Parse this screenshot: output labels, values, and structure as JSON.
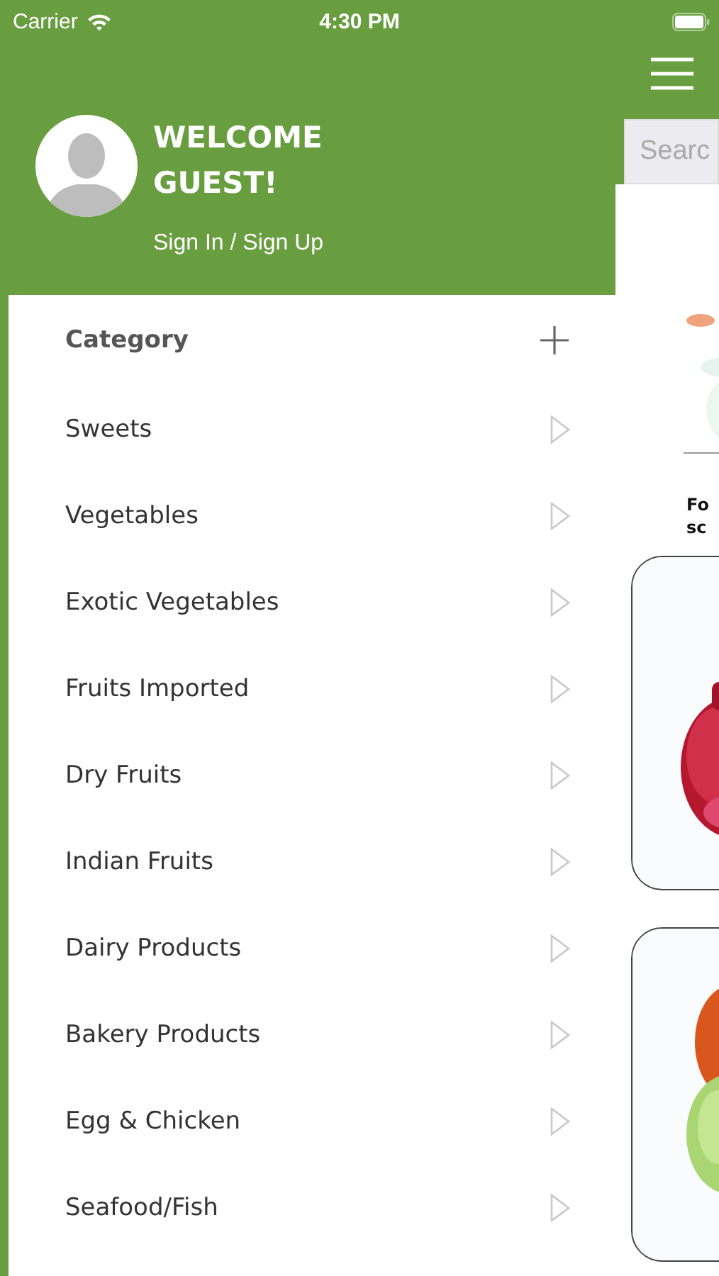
{
  "status_bar": {
    "carrier": "Carrier",
    "time": "4:30 PM"
  },
  "drawer": {
    "welcome": "WELCOME GUEST!",
    "sign_in": "Sign In / Sign Up",
    "category_header": "Category",
    "categories": [
      {
        "label": "Sweets"
      },
      {
        "label": "Vegetables"
      },
      {
        "label": "Exotic Vegetables"
      },
      {
        "label": "Fruits Imported"
      },
      {
        "label": "Dry Fruits"
      },
      {
        "label": "Indian Fruits"
      },
      {
        "label": "Dairy Products"
      },
      {
        "label": "Bakery Products"
      },
      {
        "label": "Egg & Chicken"
      },
      {
        "label": "Seafood/Fish"
      }
    ]
  },
  "main": {
    "search": {
      "placeholder": "Searc"
    },
    "heading_lines": [
      "Fo",
      "sc"
    ]
  }
}
